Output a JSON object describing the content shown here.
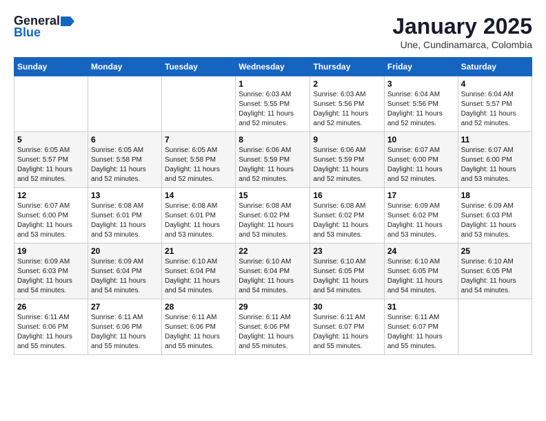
{
  "logo": {
    "general": "General",
    "blue": "Blue"
  },
  "title": "January 2025",
  "location": "Une, Cundinamarca, Colombia",
  "weekdays": [
    "Sunday",
    "Monday",
    "Tuesday",
    "Wednesday",
    "Thursday",
    "Friday",
    "Saturday"
  ],
  "weeks": [
    [
      {
        "day": "",
        "sunrise": "",
        "sunset": "",
        "daylight": ""
      },
      {
        "day": "",
        "sunrise": "",
        "sunset": "",
        "daylight": ""
      },
      {
        "day": "",
        "sunrise": "",
        "sunset": "",
        "daylight": ""
      },
      {
        "day": "1",
        "sunrise": "Sunrise: 6:03 AM",
        "sunset": "Sunset: 5:55 PM",
        "daylight": "Daylight: 11 hours and 52 minutes."
      },
      {
        "day": "2",
        "sunrise": "Sunrise: 6:03 AM",
        "sunset": "Sunset: 5:56 PM",
        "daylight": "Daylight: 11 hours and 52 minutes."
      },
      {
        "day": "3",
        "sunrise": "Sunrise: 6:04 AM",
        "sunset": "Sunset: 5:56 PM",
        "daylight": "Daylight: 11 hours and 52 minutes."
      },
      {
        "day": "4",
        "sunrise": "Sunrise: 6:04 AM",
        "sunset": "Sunset: 5:57 PM",
        "daylight": "Daylight: 11 hours and 52 minutes."
      }
    ],
    [
      {
        "day": "5",
        "sunrise": "Sunrise: 6:05 AM",
        "sunset": "Sunset: 5:57 PM",
        "daylight": "Daylight: 11 hours and 52 minutes."
      },
      {
        "day": "6",
        "sunrise": "Sunrise: 6:05 AM",
        "sunset": "Sunset: 5:58 PM",
        "daylight": "Daylight: 11 hours and 52 minutes."
      },
      {
        "day": "7",
        "sunrise": "Sunrise: 6:05 AM",
        "sunset": "Sunset: 5:58 PM",
        "daylight": "Daylight: 11 hours and 52 minutes."
      },
      {
        "day": "8",
        "sunrise": "Sunrise: 6:06 AM",
        "sunset": "Sunset: 5:59 PM",
        "daylight": "Daylight: 11 hours and 52 minutes."
      },
      {
        "day": "9",
        "sunrise": "Sunrise: 6:06 AM",
        "sunset": "Sunset: 5:59 PM",
        "daylight": "Daylight: 11 hours and 52 minutes."
      },
      {
        "day": "10",
        "sunrise": "Sunrise: 6:07 AM",
        "sunset": "Sunset: 6:00 PM",
        "daylight": "Daylight: 11 hours and 52 minutes."
      },
      {
        "day": "11",
        "sunrise": "Sunrise: 6:07 AM",
        "sunset": "Sunset: 6:00 PM",
        "daylight": "Daylight: 11 hours and 53 minutes."
      }
    ],
    [
      {
        "day": "12",
        "sunrise": "Sunrise: 6:07 AM",
        "sunset": "Sunset: 6:00 PM",
        "daylight": "Daylight: 11 hours and 53 minutes."
      },
      {
        "day": "13",
        "sunrise": "Sunrise: 6:08 AM",
        "sunset": "Sunset: 6:01 PM",
        "daylight": "Daylight: 11 hours and 53 minutes."
      },
      {
        "day": "14",
        "sunrise": "Sunrise: 6:08 AM",
        "sunset": "Sunset: 6:01 PM",
        "daylight": "Daylight: 11 hours and 53 minutes."
      },
      {
        "day": "15",
        "sunrise": "Sunrise: 6:08 AM",
        "sunset": "Sunset: 6:02 PM",
        "daylight": "Daylight: 11 hours and 53 minutes."
      },
      {
        "day": "16",
        "sunrise": "Sunrise: 6:08 AM",
        "sunset": "Sunset: 6:02 PM",
        "daylight": "Daylight: 11 hours and 53 minutes."
      },
      {
        "day": "17",
        "sunrise": "Sunrise: 6:09 AM",
        "sunset": "Sunset: 6:02 PM",
        "daylight": "Daylight: 11 hours and 53 minutes."
      },
      {
        "day": "18",
        "sunrise": "Sunrise: 6:09 AM",
        "sunset": "Sunset: 6:03 PM",
        "daylight": "Daylight: 11 hours and 53 minutes."
      }
    ],
    [
      {
        "day": "19",
        "sunrise": "Sunrise: 6:09 AM",
        "sunset": "Sunset: 6:03 PM",
        "daylight": "Daylight: 11 hours and 54 minutes."
      },
      {
        "day": "20",
        "sunrise": "Sunrise: 6:09 AM",
        "sunset": "Sunset: 6:04 PM",
        "daylight": "Daylight: 11 hours and 54 minutes."
      },
      {
        "day": "21",
        "sunrise": "Sunrise: 6:10 AM",
        "sunset": "Sunset: 6:04 PM",
        "daylight": "Daylight: 11 hours and 54 minutes."
      },
      {
        "day": "22",
        "sunrise": "Sunrise: 6:10 AM",
        "sunset": "Sunset: 6:04 PM",
        "daylight": "Daylight: 11 hours and 54 minutes."
      },
      {
        "day": "23",
        "sunrise": "Sunrise: 6:10 AM",
        "sunset": "Sunset: 6:05 PM",
        "daylight": "Daylight: 11 hours and 54 minutes."
      },
      {
        "day": "24",
        "sunrise": "Sunrise: 6:10 AM",
        "sunset": "Sunset: 6:05 PM",
        "daylight": "Daylight: 11 hours and 54 minutes."
      },
      {
        "day": "25",
        "sunrise": "Sunrise: 6:10 AM",
        "sunset": "Sunset: 6:05 PM",
        "daylight": "Daylight: 11 hours and 54 minutes."
      }
    ],
    [
      {
        "day": "26",
        "sunrise": "Sunrise: 6:11 AM",
        "sunset": "Sunset: 6:06 PM",
        "daylight": "Daylight: 11 hours and 55 minutes."
      },
      {
        "day": "27",
        "sunrise": "Sunrise: 6:11 AM",
        "sunset": "Sunset: 6:06 PM",
        "daylight": "Daylight: 11 hours and 55 minutes."
      },
      {
        "day": "28",
        "sunrise": "Sunrise: 6:11 AM",
        "sunset": "Sunset: 6:06 PM",
        "daylight": "Daylight: 11 hours and 55 minutes."
      },
      {
        "day": "29",
        "sunrise": "Sunrise: 6:11 AM",
        "sunset": "Sunset: 6:06 PM",
        "daylight": "Daylight: 11 hours and 55 minutes."
      },
      {
        "day": "30",
        "sunrise": "Sunrise: 6:11 AM",
        "sunset": "Sunset: 6:07 PM",
        "daylight": "Daylight: 11 hours and 55 minutes."
      },
      {
        "day": "31",
        "sunrise": "Sunrise: 6:11 AM",
        "sunset": "Sunset: 6:07 PM",
        "daylight": "Daylight: 11 hours and 55 minutes."
      },
      {
        "day": "",
        "sunrise": "",
        "sunset": "",
        "daylight": ""
      }
    ]
  ]
}
